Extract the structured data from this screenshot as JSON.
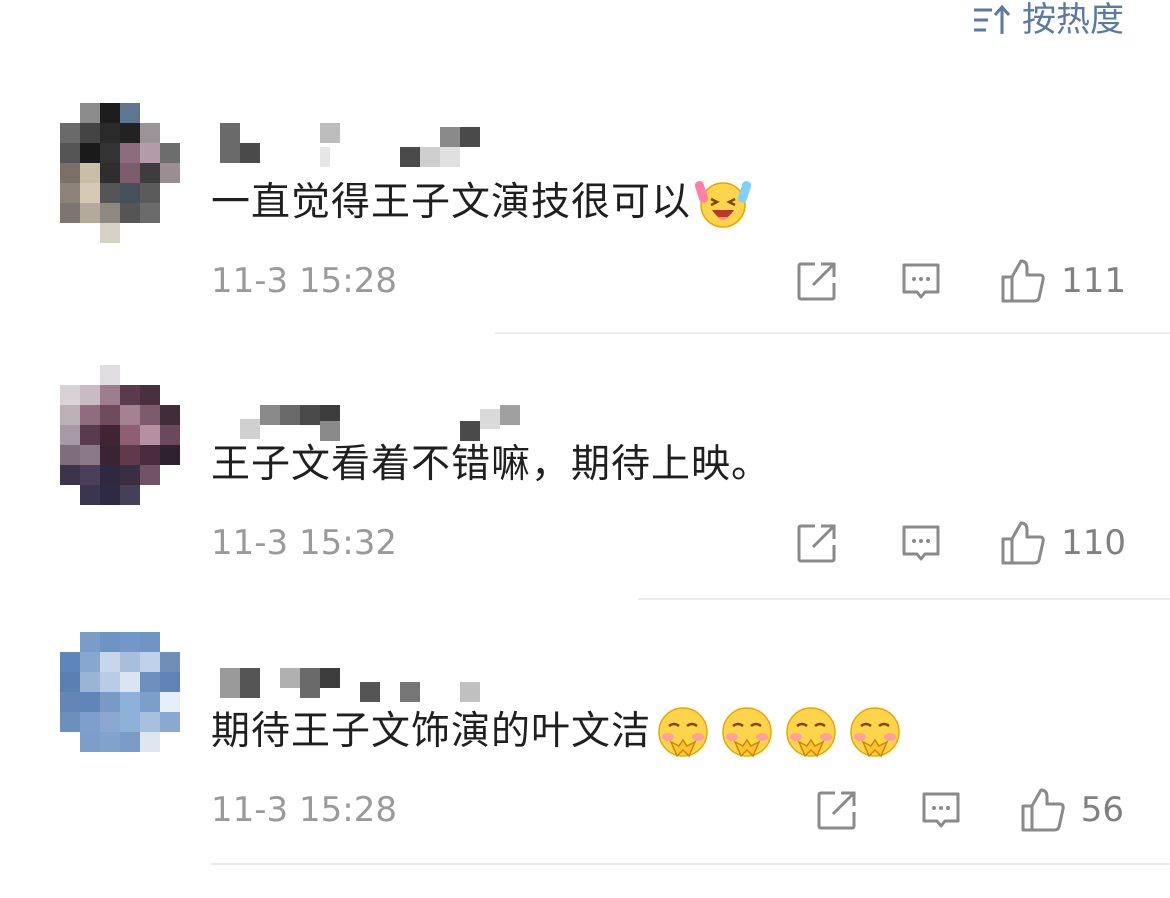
{
  "sort": {
    "label": "按热度",
    "icon": "sort-icon"
  },
  "colors": {
    "accent": "#5b7aa1",
    "text": "#1f1f1f",
    "meta": "#9a9a9a",
    "icon": "#8a8a8a",
    "divider": "#ececec"
  },
  "comments": [
    {
      "text": "一直觉得王子文演技很可以",
      "emoji": [
        "laughing-cheer-emoji"
      ],
      "time": "11-3 15:28",
      "likes": "111"
    },
    {
      "text": "王子文看着不错嘛，期待上映。",
      "emoji": [],
      "time": "11-3 15:32",
      "likes": "110"
    },
    {
      "text": "期待王子文饰演的叶文洁",
      "emoji": [
        "pleading-emoji",
        "pleading-emoji",
        "pleading-emoji",
        "pleading-emoji"
      ],
      "time": "11-3 15:28",
      "likes": "56"
    }
  ]
}
